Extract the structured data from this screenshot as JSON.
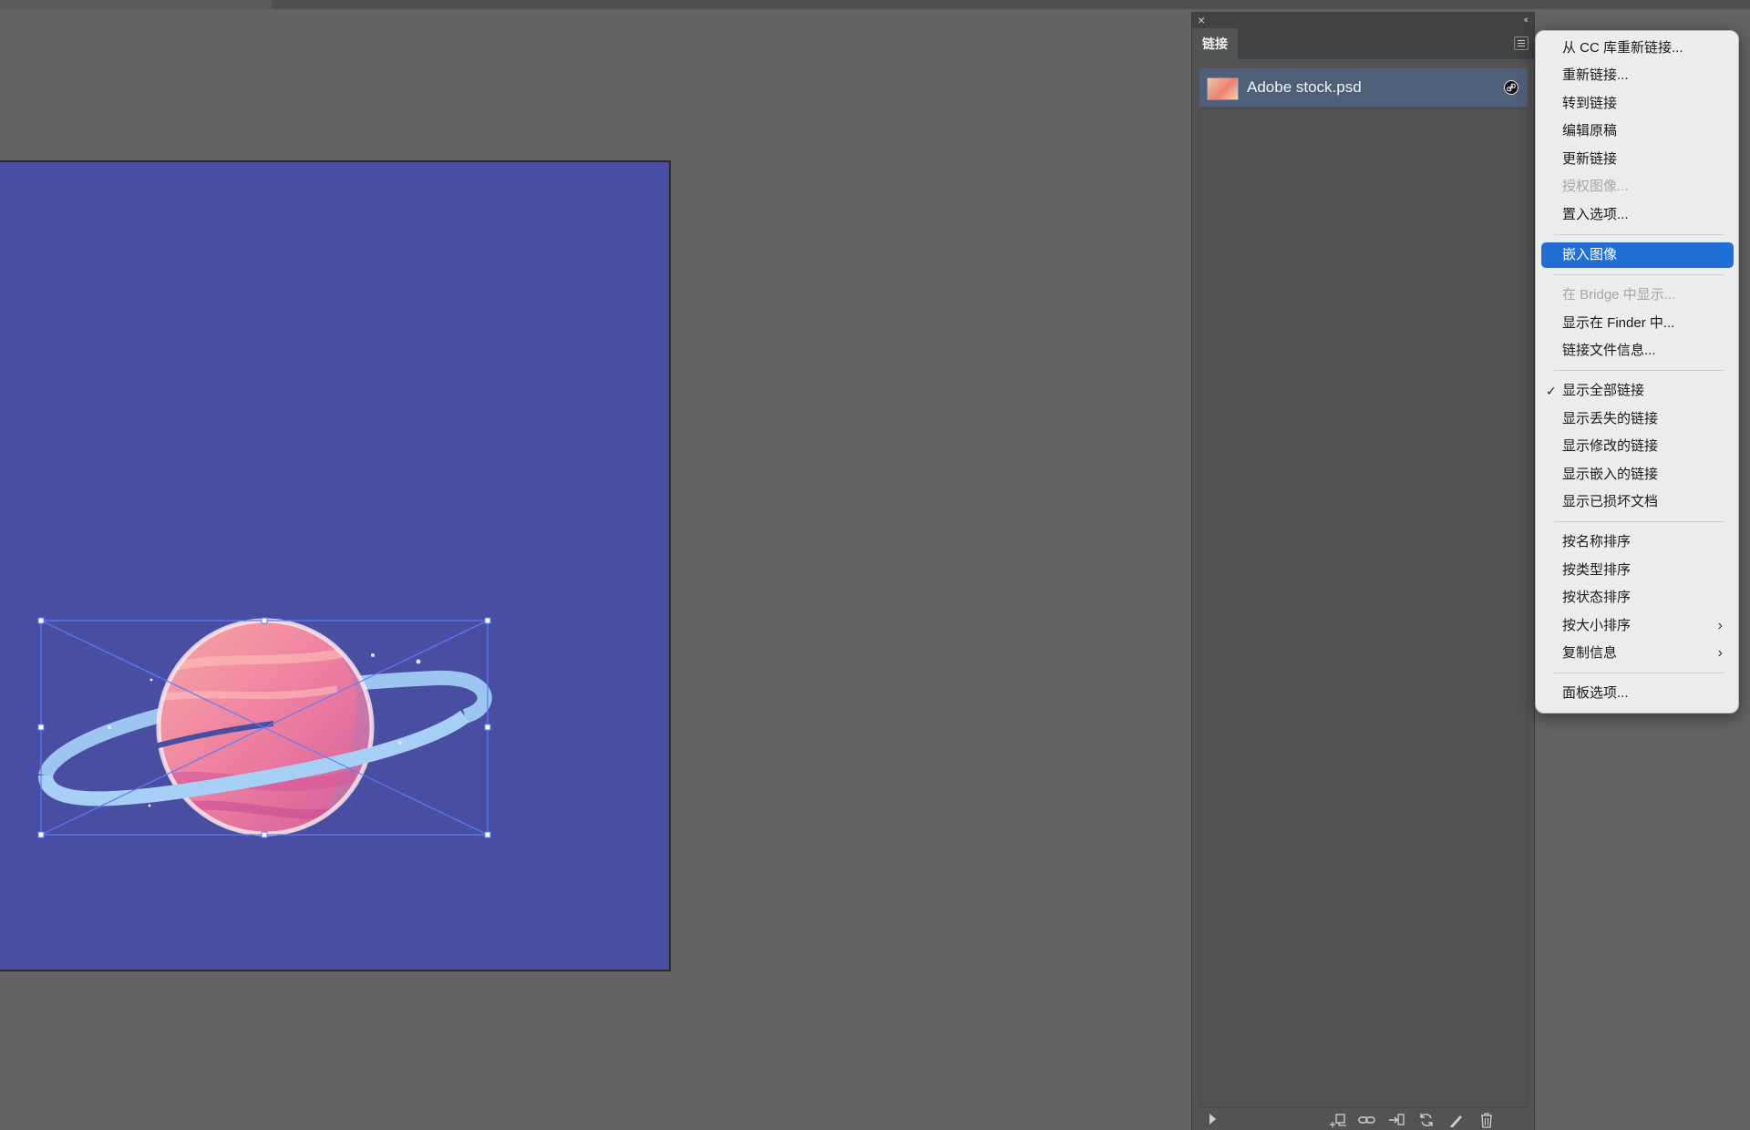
{
  "panel": {
    "tab_label": "链接",
    "close_glyph": "×",
    "collapse_glyph": "‹‹",
    "links": [
      {
        "name": "Adobe stock.psd",
        "status_icon": "linked-icon"
      }
    ]
  },
  "context_menu": {
    "items": [
      {
        "label": "从 CC 库重新链接...",
        "enabled": true
      },
      {
        "label": "重新链接...",
        "enabled": true
      },
      {
        "label": "转到链接",
        "enabled": true
      },
      {
        "label": "编辑原稿",
        "enabled": true
      },
      {
        "label": "更新链接",
        "enabled": true
      },
      {
        "label": "授权图像...",
        "enabled": false
      },
      {
        "label": "置入选项...",
        "enabled": true
      },
      {
        "label": "嵌入图像",
        "enabled": true,
        "highlighted": true
      },
      {
        "label": "在 Bridge 中显示...",
        "enabled": false
      },
      {
        "label": "显示在 Finder 中...",
        "enabled": true
      },
      {
        "label": "链接文件信息...",
        "enabled": true
      },
      {
        "label": "显示全部链接",
        "enabled": true,
        "checked": true
      },
      {
        "label": "显示丢失的链接",
        "enabled": true
      },
      {
        "label": "显示修改的链接",
        "enabled": true
      },
      {
        "label": "显示嵌入的链接",
        "enabled": true
      },
      {
        "label": "显示已损坏文档",
        "enabled": true
      },
      {
        "label": "按名称排序",
        "enabled": true
      },
      {
        "label": "按类型排序",
        "enabled": true
      },
      {
        "label": "按状态排序",
        "enabled": true
      },
      {
        "label": "按大小排序",
        "enabled": true,
        "submenu": true
      },
      {
        "label": "复制信息",
        "enabled": true,
        "submenu": true
      },
      {
        "label": "面板选项...",
        "enabled": true
      }
    ],
    "check_glyph": "✓",
    "chevron_glyph": "›"
  },
  "colors": {
    "artboard": "#4a4ea2",
    "selection": "#5a7cff",
    "menu_highlight": "#1f6fd6"
  },
  "footer_icons": [
    "relink-cc-icon",
    "relink-icon",
    "go-to-link-icon",
    "update-link-icon",
    "edit-original-icon",
    "delete-icon"
  ]
}
